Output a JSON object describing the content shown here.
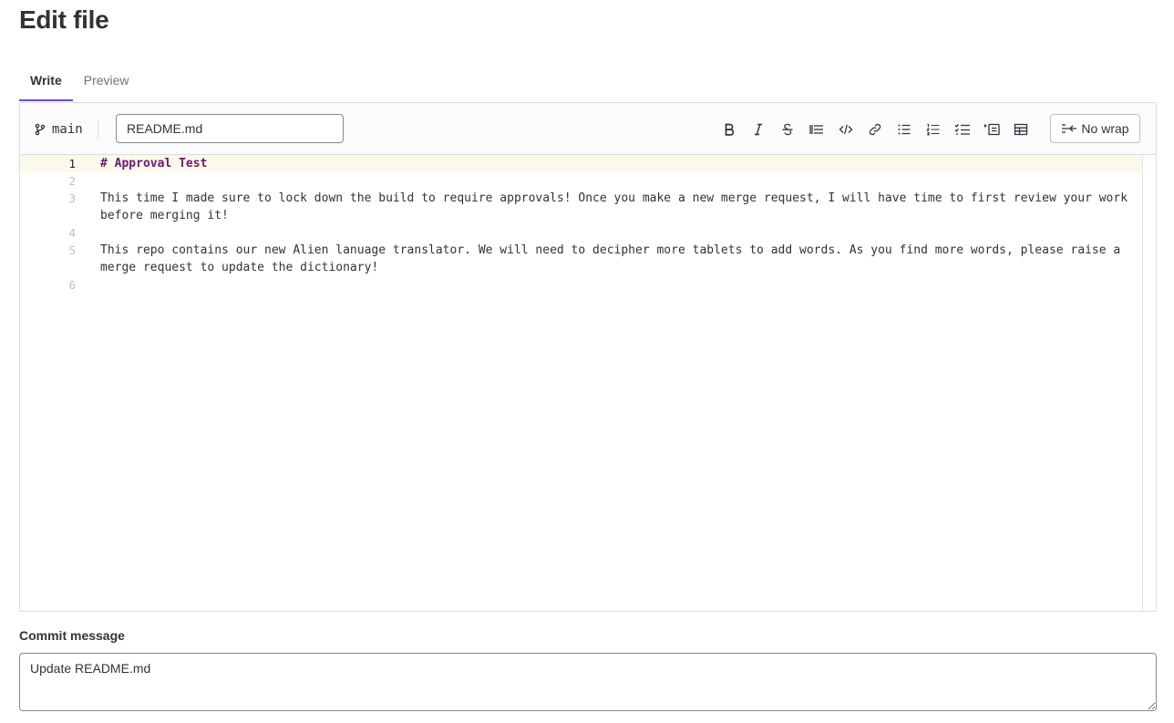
{
  "page": {
    "title": "Edit file"
  },
  "tabs": [
    {
      "label": "Write",
      "active": true
    },
    {
      "label": "Preview",
      "active": false
    }
  ],
  "editor": {
    "branch": "main",
    "file_name": "README.md",
    "toolbar_icons": [
      "bold-icon",
      "italic-icon",
      "strikethrough-icon",
      "quote-icon",
      "code-icon",
      "link-icon",
      "bulleted-list-icon",
      "numbered-list-icon",
      "task-list-icon",
      "collapsible-section-icon",
      "table-icon"
    ],
    "wrap_button_label": "No wrap",
    "current_line": 1,
    "lines": [
      {
        "number": "1",
        "text": "# Approval Test",
        "style": "heading"
      },
      {
        "number": "2",
        "text": "",
        "style": ""
      },
      {
        "number": "3",
        "text": "This time I made sure to lock down the build to require approvals! Once you make a new merge request, I will have time to first review your work before merging it!",
        "style": ""
      },
      {
        "number": "4",
        "text": "",
        "style": ""
      },
      {
        "number": "5",
        "text": "This repo contains our new Alien lanuage translator. We will need to decipher more tablets to add words. As you find more words, please raise a merge request to update the dictionary!",
        "style": ""
      },
      {
        "number": "6",
        "text": "",
        "style": ""
      }
    ]
  },
  "commit": {
    "label": "Commit message",
    "value": "Update README.md"
  },
  "colors": {
    "accent": "#6e49cb",
    "heading_syntax": "#6e1a6f",
    "current_line_bg": "#fbf9e9"
  }
}
